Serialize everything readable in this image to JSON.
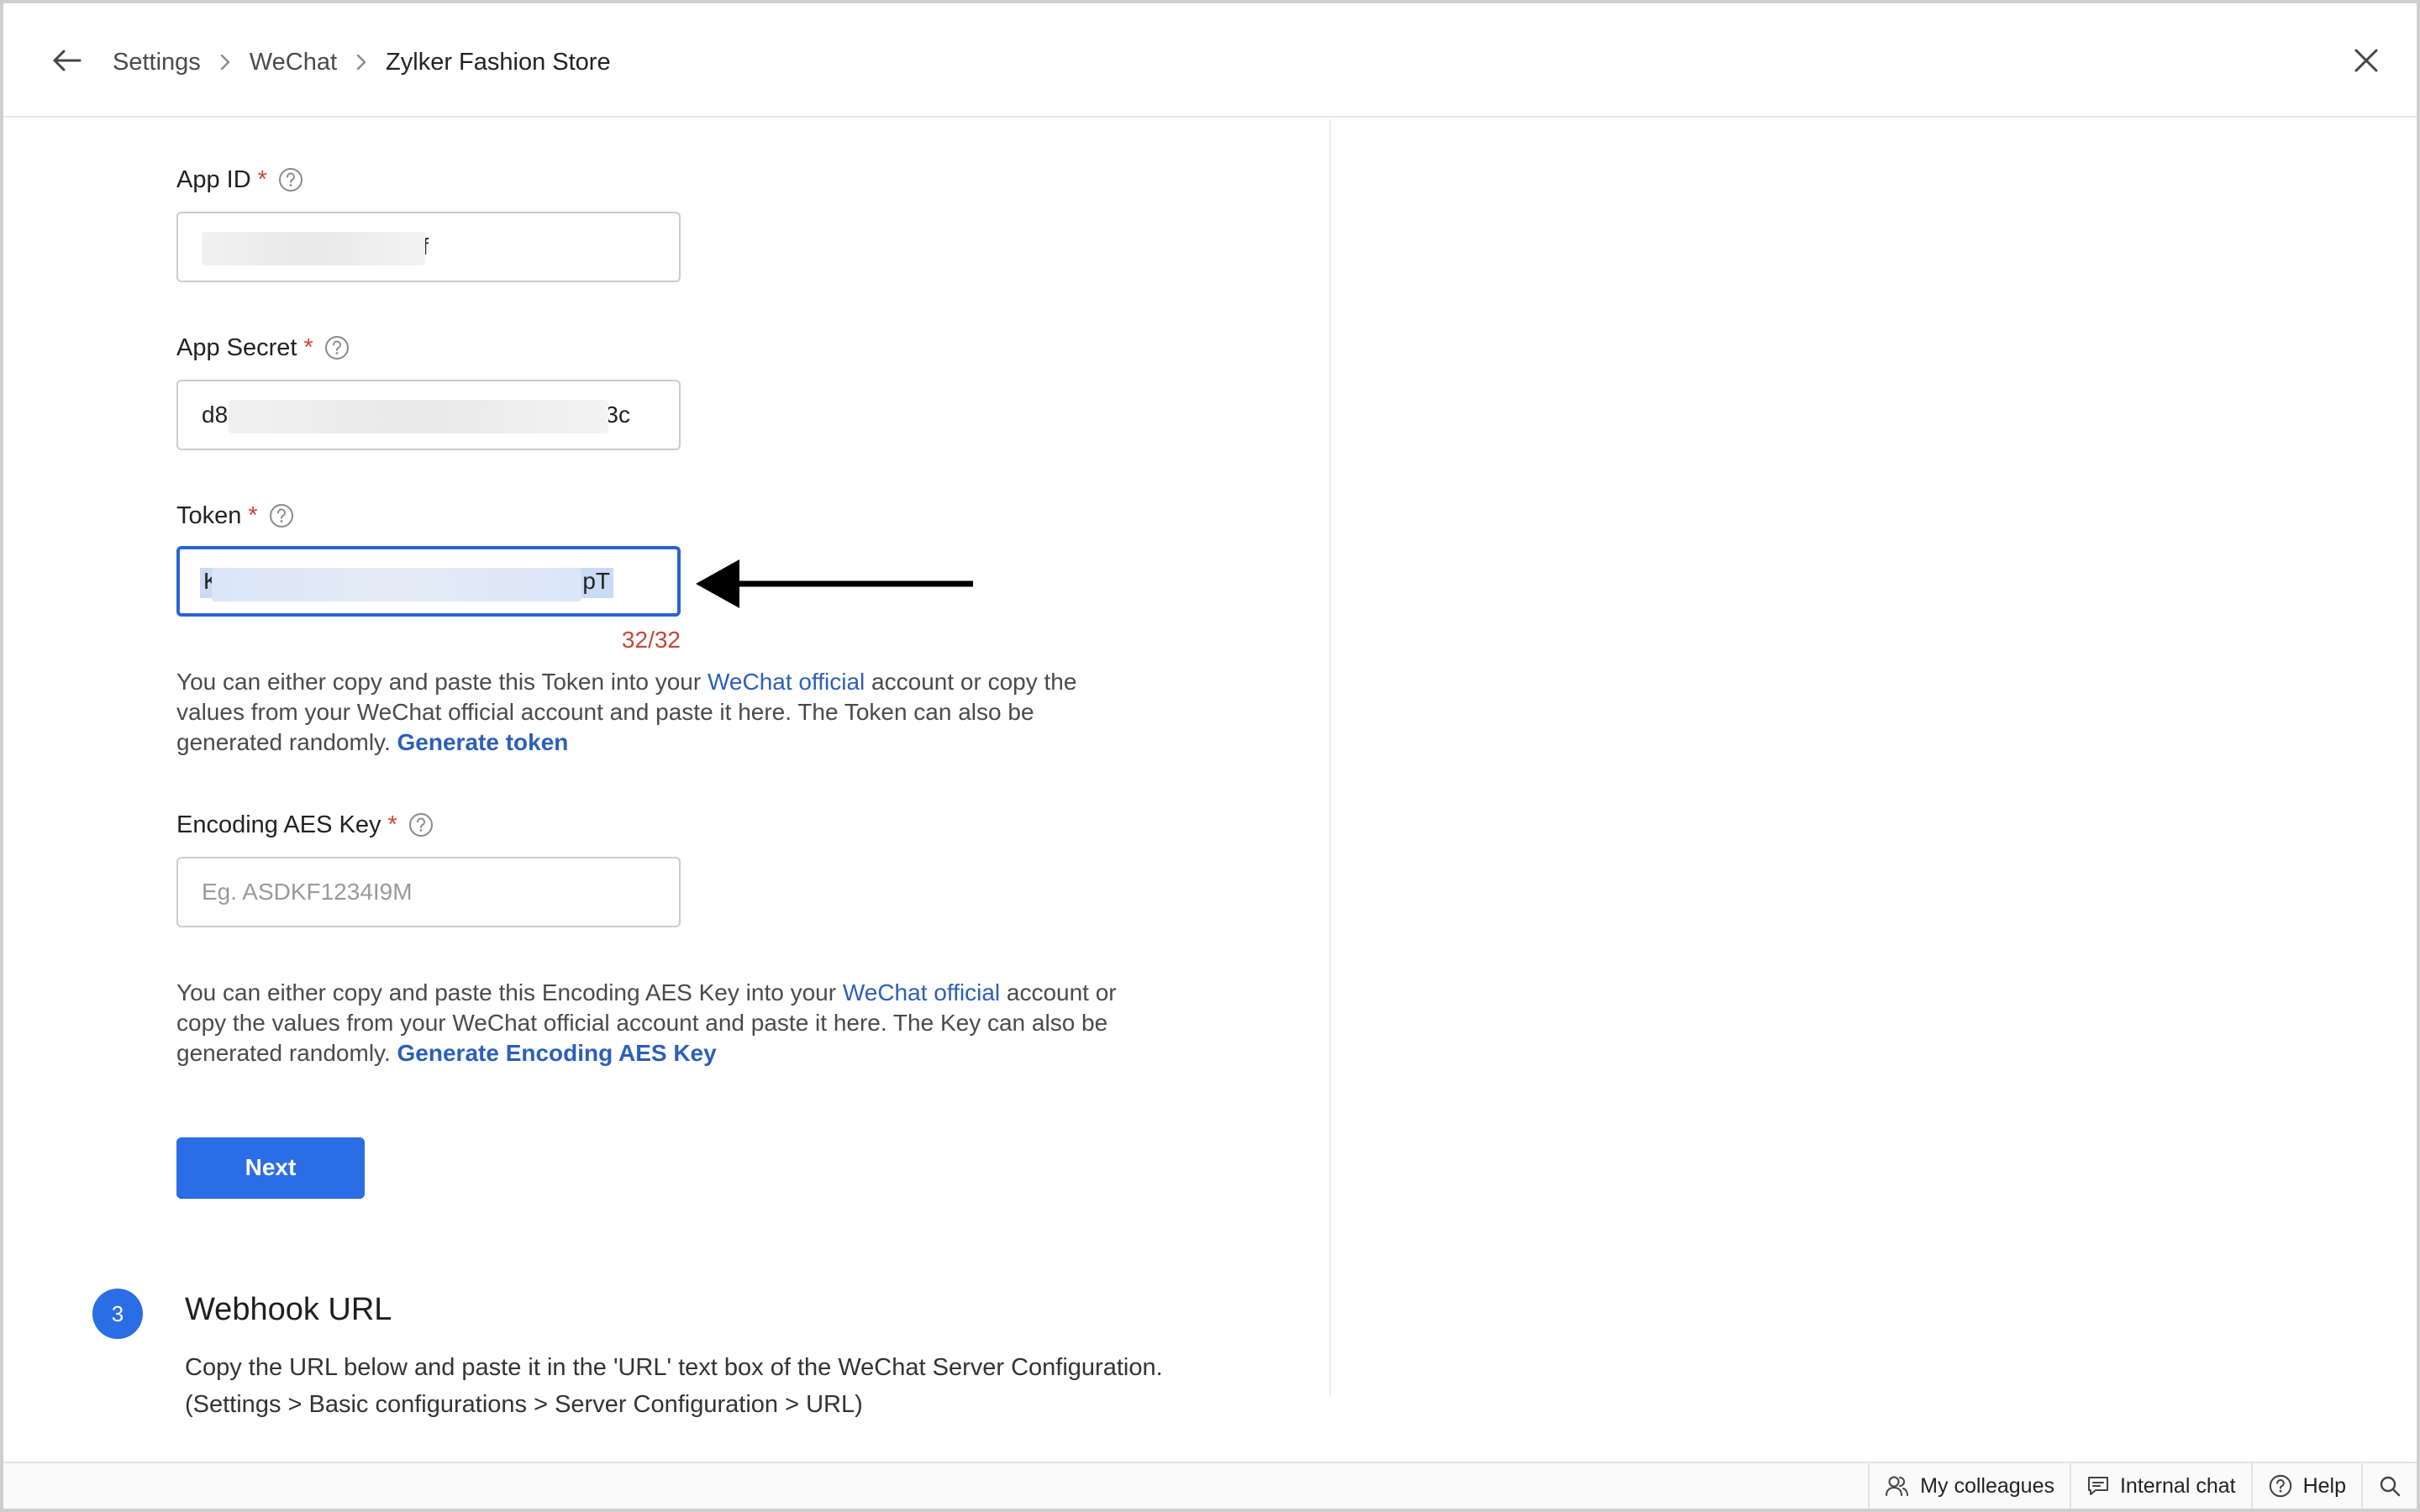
{
  "colors": {
    "accent": "#2b6de5",
    "link": "#2c5fb8",
    "required": "#d0453b",
    "counter": "#c0483b",
    "notification": "#f07a3a"
  },
  "header": {
    "breadcrumb": [
      "Settings",
      "WeChat",
      "Zylker Fashion Store"
    ],
    "icons": {
      "back": "arrow-left-icon",
      "close": "close-icon"
    }
  },
  "form": {
    "app_id": {
      "label": "App ID",
      "required_mark": "*",
      "value_start": "v",
      "value_end": "9f"
    },
    "app_secret": {
      "label": "App Secret",
      "required_mark": "*",
      "value_start": "d8",
      "value_end": "3c"
    },
    "token": {
      "label": "Token",
      "required_mark": "*",
      "value_start": "K",
      "value_end": "pT",
      "counter": "32/32",
      "help_prefix": "You can either copy and paste this Token into your ",
      "help_link": "WeChat official",
      "help_middle": " account or copy the values from your WeChat official account and paste it here. The Token can also be generated randomly. ",
      "help_action": "Generate token"
    },
    "aes_key": {
      "label": "Encoding AES Key",
      "required_mark": "*",
      "placeholder": "Eg. ASDKF1234I9M",
      "help_prefix": "You can either copy and paste this Encoding AES Key into your ",
      "help_link": "WeChat official",
      "help_middle": " account or copy the values from your WeChat official account and paste it here. The Key can also be generated randomly. ",
      "help_action": "Generate Encoding AES Key"
    },
    "next_label": "Next"
  },
  "step3": {
    "number": "3",
    "title": "Webhook URL",
    "line1": "Copy the URL below and paste it in the 'URL' text box of the WeChat Server Configuration.",
    "line2": "(Settings > Basic configurations > Server Configuration > URL)"
  },
  "footer": {
    "items": [
      {
        "label": "My colleagues",
        "icon": "users-icon"
      },
      {
        "label": "Internal chat",
        "icon": "chat-icon"
      },
      {
        "label": "Help",
        "icon": "help-icon"
      },
      {
        "label": "",
        "icon": "search-icon"
      }
    ]
  }
}
